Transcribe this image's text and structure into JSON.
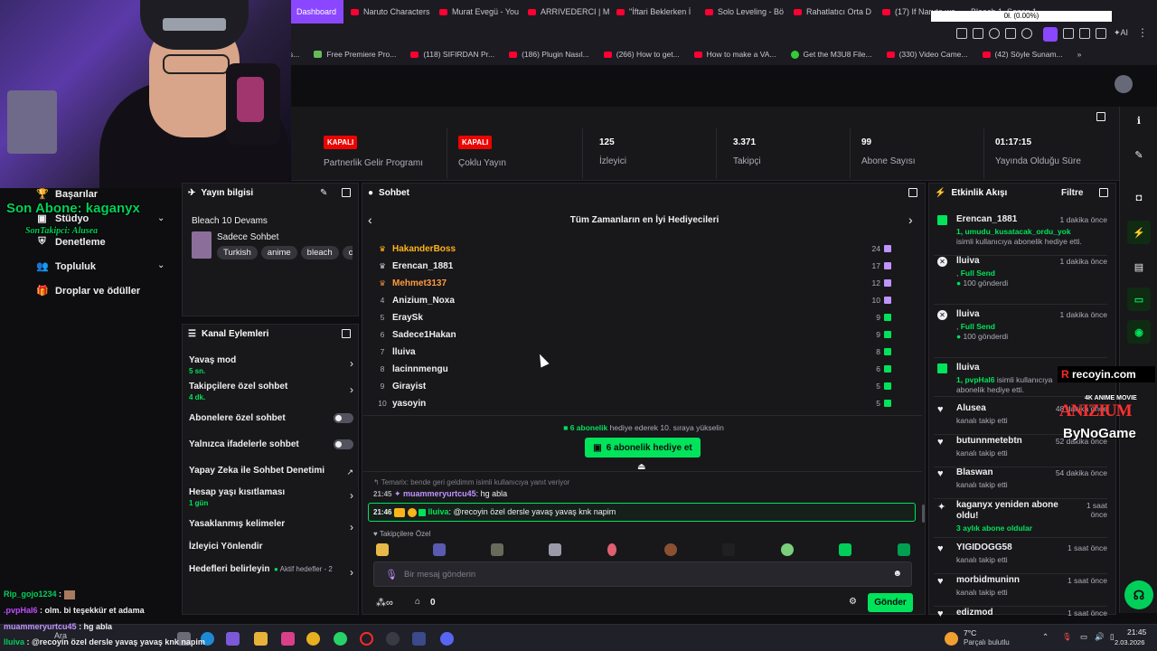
{
  "browser": {
    "tabs": [
      {
        "label": "Dashboard",
        "active": true
      },
      {
        "label": "Naruto Characters",
        "active": false
      },
      {
        "label": "Murat Evegü - You",
        "active": false
      },
      {
        "label": "ARRIVEDERCI | M",
        "active": false
      },
      {
        "label": "\"İftari Beklerken İ",
        "active": false
      },
      {
        "label": "Solo Leveling - Bö",
        "active": false
      },
      {
        "label": "Rahatlatıcı Orta D",
        "active": false
      },
      {
        "label": "(17) If Naruto wa",
        "active": false
      },
      {
        "label": "Bleach 1. Sezon 1",
        "active": false
      }
    ],
    "bookmarks": [
      "s...",
      "Free Premiere Pro...",
      "(118) SIFIRDAN Pr...",
      "(186) Plugin Nasıl...",
      "(266) How to get...",
      "How to make a VA...",
      "Get the M3U8 File...",
      "(330) Video Came...",
      "(42) Söyle Sunam..."
    ],
    "progress_text": "0ł. (0.00%)"
  },
  "overlay": {
    "son_abone": "Son Abone: kaganyx",
    "son_takipci": "SonTakipci: Alusea",
    "logo_text": "recoyin.com",
    "partners": [
      "4K ANIME MOVIE",
      "ANIZIUM",
      "ByNoGame"
    ]
  },
  "stats": [
    {
      "value": "KAPALI",
      "label": "Partnerlik Gelir Programı",
      "is_badge": true
    },
    {
      "value": "KAPALI",
      "label": "Çoklu Yayın",
      "is_badge": true
    },
    {
      "value": "125",
      "label": "İzleyici",
      "is_badge": false
    },
    {
      "value": "3.371",
      "label": "Takipçi",
      "is_badge": false
    },
    {
      "value": "99",
      "label": "Abone Sayısı",
      "is_badge": false
    },
    {
      "value": "01:17:15",
      "label": "Yayında Olduğu Süre",
      "is_badge": false
    }
  ],
  "nav": {
    "items": [
      "Başarılar",
      "Stüdyo",
      "Denetleme",
      "Topluluk",
      "Droplar ve ödüller"
    ]
  },
  "stream_info": {
    "title": "Yayın bilgisi",
    "stream_title": "Bleach 10 Devams",
    "category": "Sadece Sohbet",
    "tags": [
      "Turkish",
      "anime",
      "bleach",
      "c"
    ]
  },
  "channel_actions": {
    "title": "Kanal Eylemleri",
    "items": [
      {
        "label": "Yavaş mod",
        "sub": "5 sn.",
        "control": "arrow"
      },
      {
        "label": "Takipçilere özel sohbet",
        "sub": "4 dk.",
        "control": "arrow"
      },
      {
        "label": "Abonelere özel sohbet",
        "sub": "",
        "control": "toggle"
      },
      {
        "label": "Yalnızca ifadelerle sohbet",
        "sub": "",
        "control": "toggle"
      },
      {
        "label": "Yapay Zeka ile Sohbet Denetimi",
        "sub": "",
        "control": "external"
      },
      {
        "label": "Hesap yaşı kısıtlaması",
        "sub": "1 gün",
        "control": "arrow"
      },
      {
        "label": "Yasaklanmış kelimeler",
        "sub": "",
        "control": "arrow"
      },
      {
        "label": "İzleyici Yönlendir",
        "sub": "",
        "control": "none"
      },
      {
        "label": "Hedefleri belirleyin",
        "sub": "",
        "control": "arrow",
        "extra": "Aktif hedefler - 2"
      }
    ]
  },
  "chat": {
    "title": "Sohbet",
    "leaderboard_title": "Tüm Zamanların en İyi Hediyecileri",
    "leaderboard": [
      {
        "rank": "1",
        "name": "HakanderBoss",
        "count": "24",
        "gift": "purple"
      },
      {
        "rank": "2",
        "name": "Erencan_1881",
        "count": "17",
        "gift": "purple"
      },
      {
        "rank": "3",
        "name": "Mehmet3137",
        "count": "12",
        "gift": "purple"
      },
      {
        "rank": "4",
        "name": "Anizium_Noxa",
        "count": "10",
        "gift": "purple"
      },
      {
        "rank": "5",
        "name": "EraySk",
        "count": "9",
        "gift": "green"
      },
      {
        "rank": "6",
        "name": "Sadece1Hakan",
        "count": "9",
        "gift": "green"
      },
      {
        "rank": "7",
        "name": "lluiva",
        "count": "8",
        "gift": "green"
      },
      {
        "rank": "8",
        "name": "lacinnmengu",
        "count": "6",
        "gift": "green"
      },
      {
        "rank": "9",
        "name": "Girayist",
        "count": "5",
        "gift": "green"
      },
      {
        "rank": "10",
        "name": "yasoyin",
        "count": "5",
        "gift": "green"
      }
    ],
    "promo_count": "6 abonelik",
    "promo_rest": "hediye ederek 10. sıraya yükselin",
    "gift_button": "6 abonelik hediye et",
    "reply_note": "Temarix: bende geri geldimm isimli kullanıcıya yanıt veriyor",
    "msg1_time": "21:45",
    "msg1_user": "muammeryurtcu45",
    "msg1_text": ": hg abla",
    "msg2_time": "21:46",
    "msg2_user": "lluiva",
    "msg2_text": ": @recoyin özel dersle yavaş yavaş knk napim",
    "emote_section": "Takipçilere Özel",
    "input_placeholder": "Bir mesaj gönderin",
    "points": "0",
    "send_button": "Gönder"
  },
  "overlay_chat": [
    {
      "user": "Rip_gojo1234",
      "text": ":"
    },
    {
      "user": ".pvpHal6",
      "text": ": olm. bi teşekkür et adama"
    },
    {
      "user": "muammeryurtcu45",
      "text": ": hg abla"
    },
    {
      "user": "lluiva",
      "text": ": @recoyin özel dersle yavaş yavaş knk napim"
    }
  ],
  "events": {
    "title": "Etkinlik Akışı",
    "filter": "Filtre",
    "items": [
      {
        "name": "Erencan_1881",
        "time": "1 dakika önce",
        "highlight": "1, umudu_kusatacak_ordu_yok",
        "desc": "isimli kullanıcıya abonelik hediye etti.",
        "icon": "gift"
      },
      {
        "name": "lluiva",
        "time": "1 dakika önce",
        "highlight": "Full Send",
        "desc": "100 gönderdi",
        "icon": "kick"
      },
      {
        "name": "lluiva",
        "time": "1 dakika önce",
        "highlight": "Full Send",
        "desc": "100 gönderdi",
        "icon": "kick"
      },
      {
        "name": "lluiva",
        "time": "",
        "highlight": "1, pvpHal6",
        "desc": "isimli kullanıcıya abonelik hediye etti.",
        "icon": "gift"
      },
      {
        "name": "Alusea",
        "time": "48 dakika önce",
        "highlight": "",
        "desc": "kanalı takip etti",
        "icon": "heart"
      },
      {
        "name": "butunnmetebtn",
        "time": "52 dakika önce",
        "highlight": "",
        "desc": "kanalı takip etti",
        "icon": "heart"
      },
      {
        "name": "Blaswan",
        "time": "54 dakika önce",
        "highlight": "",
        "desc": "kanalı takip etti",
        "icon": "heart"
      },
      {
        "name": "kaganyx yeniden abone oldu!",
        "time": "1 saat önce",
        "highlight": "3 aylık abone oldular",
        "desc": "",
        "icon": "star"
      },
      {
        "name": "YIGIDOGG58",
        "time": "1 saat önce",
        "highlight": "",
        "desc": "kanalı takip etti",
        "icon": "heart"
      },
      {
        "name": "morbidmuninn",
        "time": "1 saat önce",
        "highlight": "",
        "desc": "kanalı takip etti",
        "icon": "heart"
      },
      {
        "name": "edizmod",
        "time": "1 saat önce",
        "highlight": "",
        "desc": "",
        "icon": "heart"
      }
    ]
  },
  "taskbar": {
    "search": "Ara",
    "weather_temp": "7°C",
    "weather_desc": "Parçalı bulutlu",
    "time": "21:45",
    "date": "2.03.2026"
  },
  "colors": {
    "accent": "#00e35a",
    "purple": "#8b46ff",
    "live": "#eb0400",
    "bg": "#0e0e10",
    "panel": "#18181b"
  }
}
